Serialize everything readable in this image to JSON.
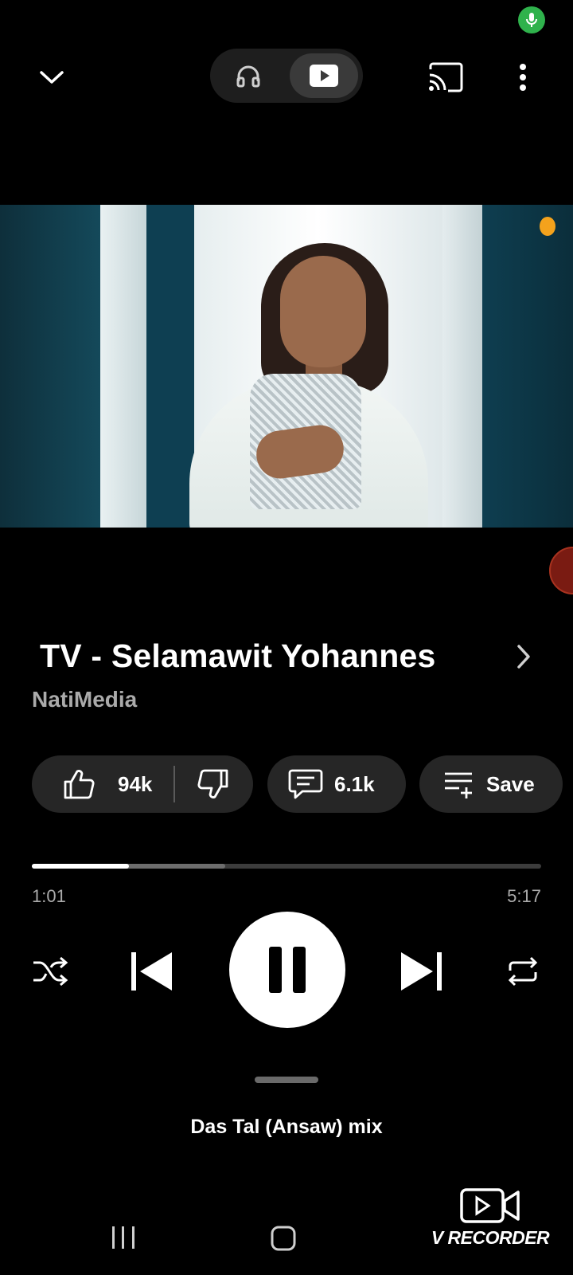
{
  "header": {
    "mode_options": [
      "audio",
      "video"
    ],
    "selected_mode": "video"
  },
  "player": {
    "title": "TV - Selamawit Yohannes",
    "channel": "NatiMedia",
    "likes": "94k",
    "comments": "6.1k",
    "save_label": "Save",
    "progress": {
      "current": "1:01",
      "duration": "5:17",
      "played_fraction": 0.19,
      "buffered_fraction": 0.38
    },
    "state": "playing"
  },
  "up_next": {
    "label": "Das Tal (Ansaw) mix"
  },
  "overlay": {
    "recorder_label": "V RECORDER"
  },
  "colors": {
    "background": "#000000",
    "pill": "#262626",
    "secondary_text": "#aaaaaa",
    "mic_indicator": "#2fb24c"
  },
  "icons": {
    "collapse": "chevron-down-icon",
    "audio_mode": "headphones-icon",
    "video_mode": "play-video-icon",
    "cast": "cast-icon",
    "more": "more-vertical-icon",
    "like": "thumbs-up-icon",
    "dislike": "thumbs-down-icon",
    "comment": "comment-icon",
    "save": "playlist-add-icon",
    "shuffle": "shuffle-icon",
    "previous": "skip-previous-icon",
    "pause": "pause-icon",
    "next": "skip-next-icon",
    "repeat": "repeat-icon"
  }
}
